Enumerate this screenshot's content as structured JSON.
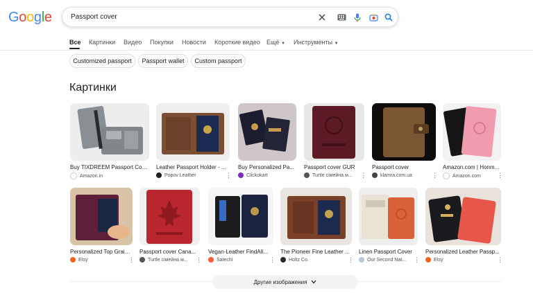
{
  "logo": {
    "text": "Google"
  },
  "search": {
    "query": "Passport cover"
  },
  "tabs": [
    {
      "label": "Все"
    },
    {
      "label": "Картинки"
    },
    {
      "label": "Видео"
    },
    {
      "label": "Покупки"
    },
    {
      "label": "Новости"
    },
    {
      "label": "Короткие видео"
    },
    {
      "label": "Ещё"
    },
    {
      "label": "Инструменты"
    }
  ],
  "chips": [
    {
      "label": "Customized passport"
    },
    {
      "label": "Passport wallet"
    },
    {
      "label": "Custom passport"
    }
  ],
  "images_section": {
    "title": "Картинки",
    "row1": [
      {
        "title": "Buy TIXDREEM Passport Cov...",
        "source": "Amazon.in"
      },
      {
        "title": "Leather Passport Holder - ...",
        "source": "Popov Leather"
      },
      {
        "title": "Buy Personalized Pa...",
        "source": "Clickokart"
      },
      {
        "title": "Passport cover GUR",
        "source": "Turtle сімейна м..."
      },
      {
        "title": "Passport cover",
        "source": "klamra.com.ua"
      },
      {
        "title": "Amazon.com | Honm...",
        "source": "Amazon.com"
      }
    ],
    "row2": [
      {
        "title": "Personalized Top Grain...",
        "source": "Etsy"
      },
      {
        "title": "Passport cover Cana...",
        "source": "Turtle сімейна м..."
      },
      {
        "title": "Vegan-Leather FindAll™...",
        "source": "Satechi"
      },
      {
        "title": "The Pioneer Fine Leather ...",
        "source": "Holtz Co."
      },
      {
        "title": "Linen Passport Cover",
        "source": "Our Second Nat..."
      },
      {
        "title": "Personalized Leather Passp...",
        "source": "Etsy"
      }
    ]
  },
  "more_button": {
    "label": "Другие изображения"
  },
  "colors": {
    "accent": "#1a73e8",
    "text": "#202124",
    "muted": "#4d5156"
  }
}
